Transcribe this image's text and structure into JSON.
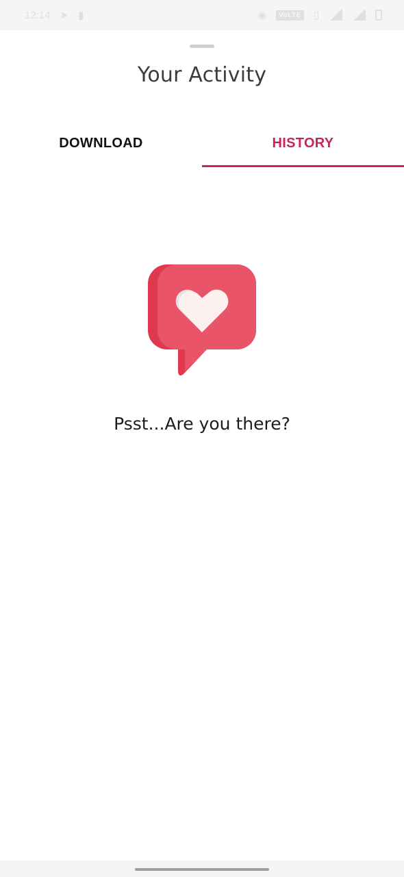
{
  "status_bar": {
    "time": "12:14",
    "network_badge": "VoLTE",
    "icons": [
      "telegram-icon",
      "notification-icon",
      "hotspot-icon",
      "volte-icon",
      "vibrate-icon",
      "wifi-signal-icon",
      "cell-signal-icon",
      "battery-icon"
    ]
  },
  "sheet": {
    "title": "Your Activity"
  },
  "tabs": [
    {
      "label": "DOWNLOAD",
      "selected": false
    },
    {
      "label": "HISTORY",
      "selected": true
    }
  ],
  "empty_state": {
    "icon": "heart-speech-bubble-icon",
    "message": "Psst...Are you there?"
  },
  "colors": {
    "accent": "#c8235d",
    "bubble": "#ea5468",
    "bubble_shade": "#e0384f",
    "heart": "#fdf1f0",
    "heart_shade": "#e6e2e4"
  }
}
